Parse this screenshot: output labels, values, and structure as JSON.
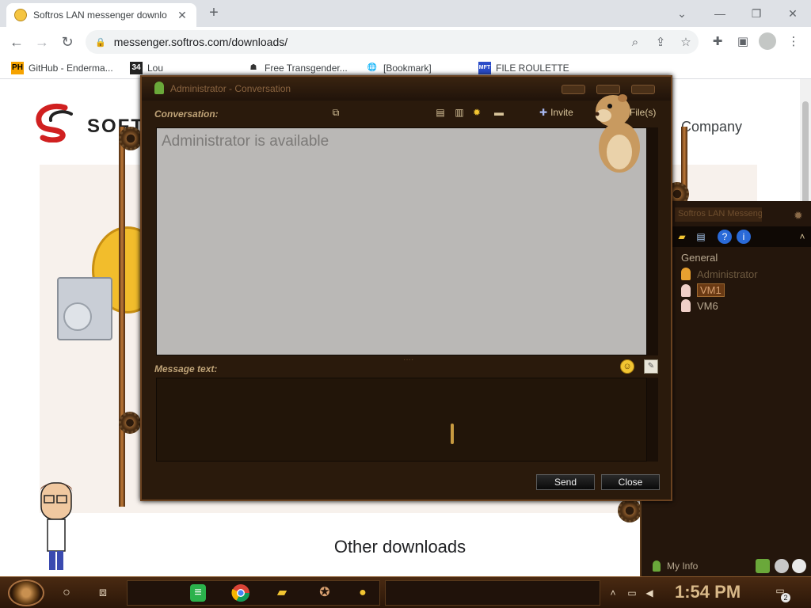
{
  "browser": {
    "tab": {
      "title": "Softros LAN messenger downlo",
      "close": "✕"
    },
    "new_tab": "+",
    "window_controls": {
      "dropdown": "⌄",
      "minimize": "—",
      "restore": "❐",
      "close": "✕"
    },
    "url": "messenger.softros.com/downloads/",
    "bookmarks": [
      {
        "label": "GitHub - Enderma...",
        "icon": "PH"
      },
      {
        "label": "Lou",
        "icon": "34"
      },
      {
        "label": "Free Transgender...",
        "icon": "S"
      },
      {
        "label": "[Bookmark]",
        "icon": "globe"
      },
      {
        "label": "FILE ROULETTE",
        "icon": "MFT"
      }
    ]
  },
  "page": {
    "logo_text": "SOFT",
    "company_text": "Company",
    "other_downloads": "Other downloads"
  },
  "contact_list": {
    "title": "Softros LAN Messenger",
    "group": "General",
    "contacts": [
      {
        "name": "Administrator",
        "status": "online"
      },
      {
        "name": "VM1",
        "status": "selected"
      },
      {
        "name": "VM6",
        "status": "away"
      }
    ],
    "my_info": "My Info"
  },
  "conversation": {
    "title": "Administrator - Conversation",
    "conversation_label": "Conversation:",
    "invite": "Invite",
    "files": "File(s)",
    "history_text": "Administrator is available",
    "message_label": "Message text:",
    "message_value": "",
    "send": "Send",
    "close": "Close"
  },
  "taskbar": {
    "clock": "1:54 PM",
    "notifications": "2"
  },
  "colors": {
    "frame_dark": "#2a1a0c",
    "brass": "#c07a38",
    "history_bg": "#bab8b6",
    "label_gold": "#c0a478"
  }
}
